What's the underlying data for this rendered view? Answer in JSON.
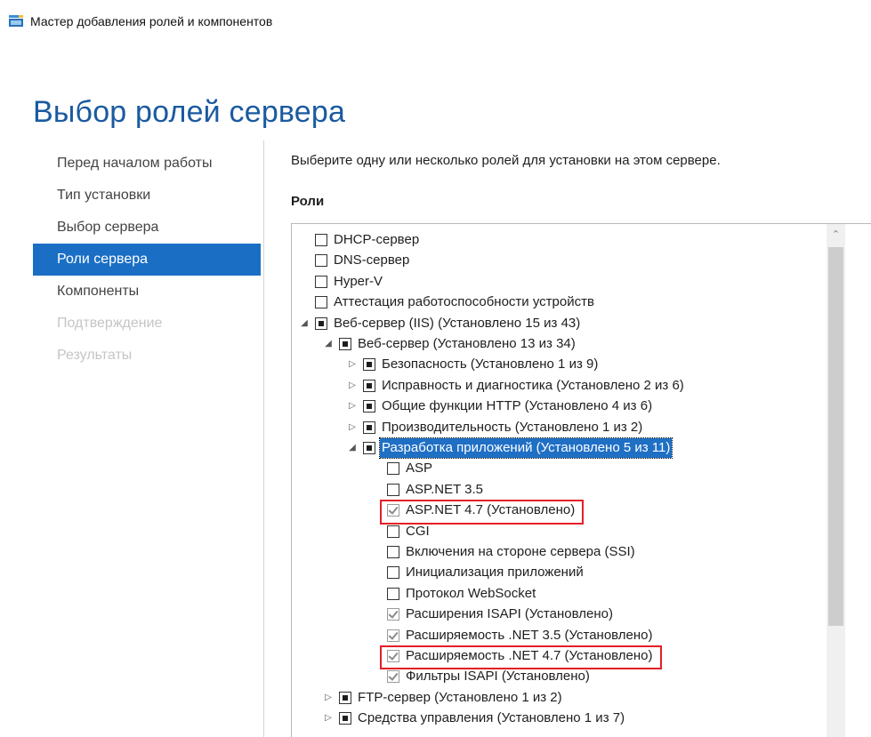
{
  "window": {
    "title": "Мастер добавления ролей и компонентов",
    "icon": "server-wizard-icon"
  },
  "page_title": "Выбор ролей сервера",
  "nav": {
    "items": [
      {
        "label": "Перед началом работы",
        "state": "normal"
      },
      {
        "label": "Тип установки",
        "state": "normal"
      },
      {
        "label": "Выбор сервера",
        "state": "normal"
      },
      {
        "label": "Роли сервера",
        "state": "active"
      },
      {
        "label": "Компоненты",
        "state": "normal"
      },
      {
        "label": "Подтверждение",
        "state": "disabled"
      },
      {
        "label": "Результаты",
        "state": "disabled"
      }
    ]
  },
  "main": {
    "instruction": "Выберите одну или несколько ролей для установки на этом сервере.",
    "roles_label": "Роли"
  },
  "roles": [
    {
      "label": "DHCP-сервер",
      "level": 0,
      "expander": "none",
      "check": "unchecked"
    },
    {
      "label": "DNS-сервер",
      "level": 0,
      "expander": "none",
      "check": "unchecked"
    },
    {
      "label": "Hyper-V",
      "level": 0,
      "expander": "none",
      "check": "unchecked"
    },
    {
      "label": "Аттестация работоспособности устройств",
      "level": 0,
      "expander": "none",
      "check": "unchecked"
    },
    {
      "label": "Веб-сервер (IIS) (Установлено 15 из 43)",
      "level": 0,
      "expander": "expanded",
      "check": "partial"
    },
    {
      "label": "Веб-сервер (Установлено 13 из 34)",
      "level": 1,
      "expander": "expanded",
      "check": "partial"
    },
    {
      "label": "Безопасность (Установлено 1 из 9)",
      "level": 2,
      "expander": "collapsed",
      "check": "partial"
    },
    {
      "label": "Исправность и диагностика (Установлено 2 из 6)",
      "level": 2,
      "expander": "collapsed",
      "check": "partial"
    },
    {
      "label": "Общие функции HTTP (Установлено 4 из 6)",
      "level": 2,
      "expander": "collapsed",
      "check": "partial"
    },
    {
      "label": "Производительность (Установлено 1 из 2)",
      "level": 2,
      "expander": "collapsed",
      "check": "partial"
    },
    {
      "label": "Разработка приложений (Установлено 5 из 11)",
      "level": 2,
      "expander": "expanded",
      "check": "partial",
      "selected": true
    },
    {
      "label": "ASP",
      "level": 3,
      "expander": "none",
      "check": "unchecked"
    },
    {
      "label": "ASP.NET 3.5",
      "level": 3,
      "expander": "none",
      "check": "unchecked"
    },
    {
      "label": "ASP.NET 4.7 (Установлено)",
      "level": 3,
      "expander": "none",
      "check": "checked",
      "highlighted": true
    },
    {
      "label": "CGI",
      "level": 3,
      "expander": "none",
      "check": "unchecked"
    },
    {
      "label": "Включения на стороне сервера (SSI)",
      "level": 3,
      "expander": "none",
      "check": "unchecked"
    },
    {
      "label": "Инициализация приложений",
      "level": 3,
      "expander": "none",
      "check": "unchecked"
    },
    {
      "label": "Протокол WebSocket",
      "level": 3,
      "expander": "none",
      "check": "unchecked"
    },
    {
      "label": "Расширения ISAPI (Установлено)",
      "level": 3,
      "expander": "none",
      "check": "checked"
    },
    {
      "label": "Расширяемость .NET 3.5 (Установлено)",
      "level": 3,
      "expander": "none",
      "check": "checked"
    },
    {
      "label": "Расширяемость .NET 4.7 (Установлено)",
      "level": 3,
      "expander": "none",
      "check": "checked",
      "highlighted": true
    },
    {
      "label": "Фильтры ISAPI (Установлено)",
      "level": 3,
      "expander": "none",
      "check": "checked"
    },
    {
      "label": "FTP-сервер (Установлено 1 из 2)",
      "level": 1,
      "expander": "collapsed",
      "check": "partial"
    },
    {
      "label": "Средства управления (Установлено 1 из 7)",
      "level": 1,
      "expander": "collapsed",
      "check": "partial"
    }
  ],
  "colors": {
    "accent": "#1a6fc5",
    "title": "#1a5aa0",
    "highlight": "#e41e26"
  }
}
